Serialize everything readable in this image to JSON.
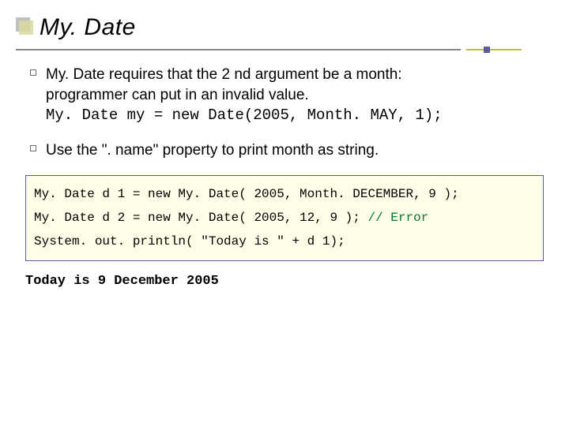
{
  "title": "My. Date",
  "bullets": [
    {
      "line1": "My. Date requires that the 2 nd argument be a month:",
      "line2": "programmer can put in an invalid value.",
      "code": "My. Date my = new Date(2005, Month. MAY, 1);"
    },
    {
      "line1": "Use the \". name\" property to print month as string."
    }
  ],
  "codebox": {
    "l1": "My. Date d 1 = new My. Date( 2005, Month. DECEMBER, 9 );",
    "l2a": "My. Date d 2 = new My. Date( 2005, 12, 9 ); ",
    "l2b": "// Error",
    "l3": "System. out. println( \"Today is \" + d 1);"
  },
  "output": "Today is 9 December 2005"
}
